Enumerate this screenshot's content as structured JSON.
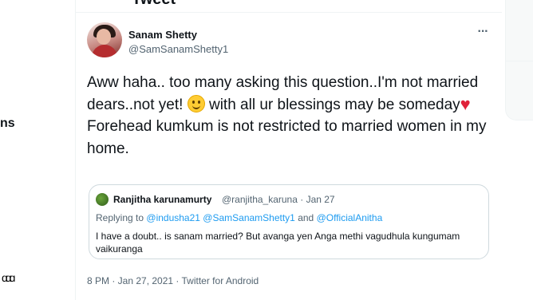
{
  "header": {
    "title": "Tweet"
  },
  "left_nav": {
    "fragment": "ns"
  },
  "tweet": {
    "author_name": "Sanam Shetty",
    "author_handle": "@SamSanamShetty1",
    "more_icon": "more-horizontal-icon",
    "text_line1": "Aww haha.. too many asking this question..I'm not married dears..not yet!",
    "text_line2": "with all ur blessings may be someday",
    "text_line3": "Forehead kumkum is not restricted to married women in my home.",
    "quote": {
      "name": "Ranjitha karunamurty",
      "handle_date": "@ranjitha_karuna · Jan 27",
      "replying_prefix": "Replying to",
      "replying_users": "@indusha21 @SamSanamShetty1",
      "replying_and": "and",
      "replying_last": "@OfficialAnitha",
      "body": "I have a doubt.. is sanam married? But avanga yen Anga methi vagudhula kungumam vaikuranga"
    },
    "timestamp": "8 PM · Jan 27, 2021 · Twitter for Android"
  },
  "colors": {
    "text": "#0f1419",
    "secondary": "#536471",
    "link": "#1d9bf0",
    "heart": "#e0223a"
  }
}
